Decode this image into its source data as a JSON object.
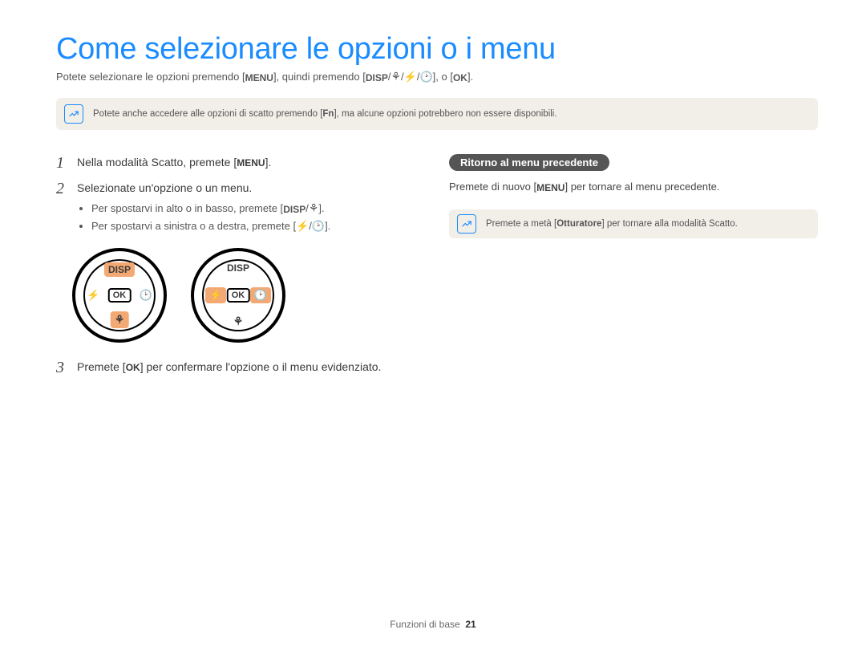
{
  "title": "Come selezionare le opzioni o i menu",
  "intro": {
    "pre": "Potete selezionare le opzioni premendo [",
    "menu": "MENU",
    "mid": "], quindi premendo [",
    "disp": "DISP",
    "sep": "/",
    "tail": "], o [",
    "ok": "OK",
    "end": "]."
  },
  "note1": {
    "pre": "Potete anche accedere alle opzioni di scatto premendo [",
    "fn": "Fn",
    "post": "], ma alcune opzioni potrebbero non essere disponibili."
  },
  "steps": {
    "s1": {
      "num": "1",
      "pre": "Nella modalità Scatto, premete [",
      "menu": "MENU",
      "post": "]."
    },
    "s2": {
      "num": "2",
      "text": "Selezionate un'opzione o un menu.",
      "b1": {
        "pre": "Per spostarvi in alto o in basso, premete [",
        "disp": "DISP",
        "sep": "/",
        "post": "]."
      },
      "b2": {
        "pre": "Per spostarvi a sinistra o a destra, premete [",
        "sep": "/",
        "post": "]."
      }
    },
    "s3": {
      "num": "3",
      "pre": "Premete [",
      "ok": "OK",
      "post": "] per confermare l'opzione o il menu evidenziato."
    }
  },
  "dial": {
    "disp": "DISP",
    "ok": "OK"
  },
  "right": {
    "heading": "Ritorno al menu precedente",
    "text_pre": "Premete di nuovo [",
    "menu": "MENU",
    "text_post": "] per tornare al menu precedente.",
    "note": {
      "pre": "Premete a metà [",
      "shutter": "Otturatore",
      "post": "] per tornare alla modalità Scatto."
    }
  },
  "footer": {
    "section": "Funzioni di base",
    "page": "21"
  }
}
